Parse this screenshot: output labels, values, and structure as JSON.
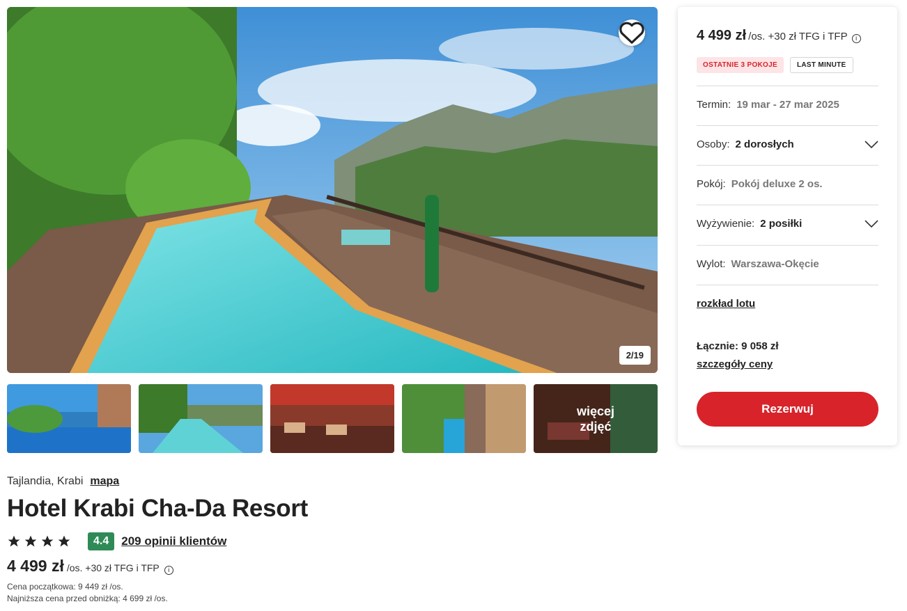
{
  "gallery": {
    "counter": "2/19",
    "more_photos_label": "więcej zdjęć",
    "favorite_icon": "heart-icon"
  },
  "hotel": {
    "location": "Tajlandia, Krabi",
    "map_link": "mapa",
    "name": "Hotel Krabi Cha-Da Resort",
    "stars": 4,
    "score": "4.4",
    "reviews_link": "209 opinii klientów",
    "price": "4 499 zł",
    "price_suffix": "/os. +30 zł TFG i TFP",
    "initial_price": "Cena początkowa: 9 449 zł /os.",
    "lowest_price": "Najniższa cena przed obniżką: 4 699 zł /os."
  },
  "booking": {
    "price": "4 499 zł",
    "price_suffix": "/os. +30 zł TFG i TFP",
    "badge_rooms": "OSTATNIE 3 POKOJE",
    "badge_last_minute": "LAST MINUTE",
    "term_label": "Termin:",
    "term_value": "19 mar - 27 mar 2025",
    "persons_label": "Osoby:",
    "persons_value": "2 dorosłych",
    "room_label": "Pokój:",
    "room_value": "Pokój deluxe 2 os.",
    "board_label": "Wyżywienie:",
    "board_value": "2 posiłki",
    "departure_label": "Wylot:",
    "departure_value": "Warszawa-Okęcie",
    "flight_schedule_link": "rozkład lotu",
    "total": "Łącznie: 9 058 zł",
    "price_details_link": "szczegóły ceny",
    "reserve_button": "Rezerwuj"
  },
  "colors": {
    "accent_red": "#d8232a",
    "rating_green": "#2e8b57",
    "badge_pink": "#fde4e6"
  }
}
